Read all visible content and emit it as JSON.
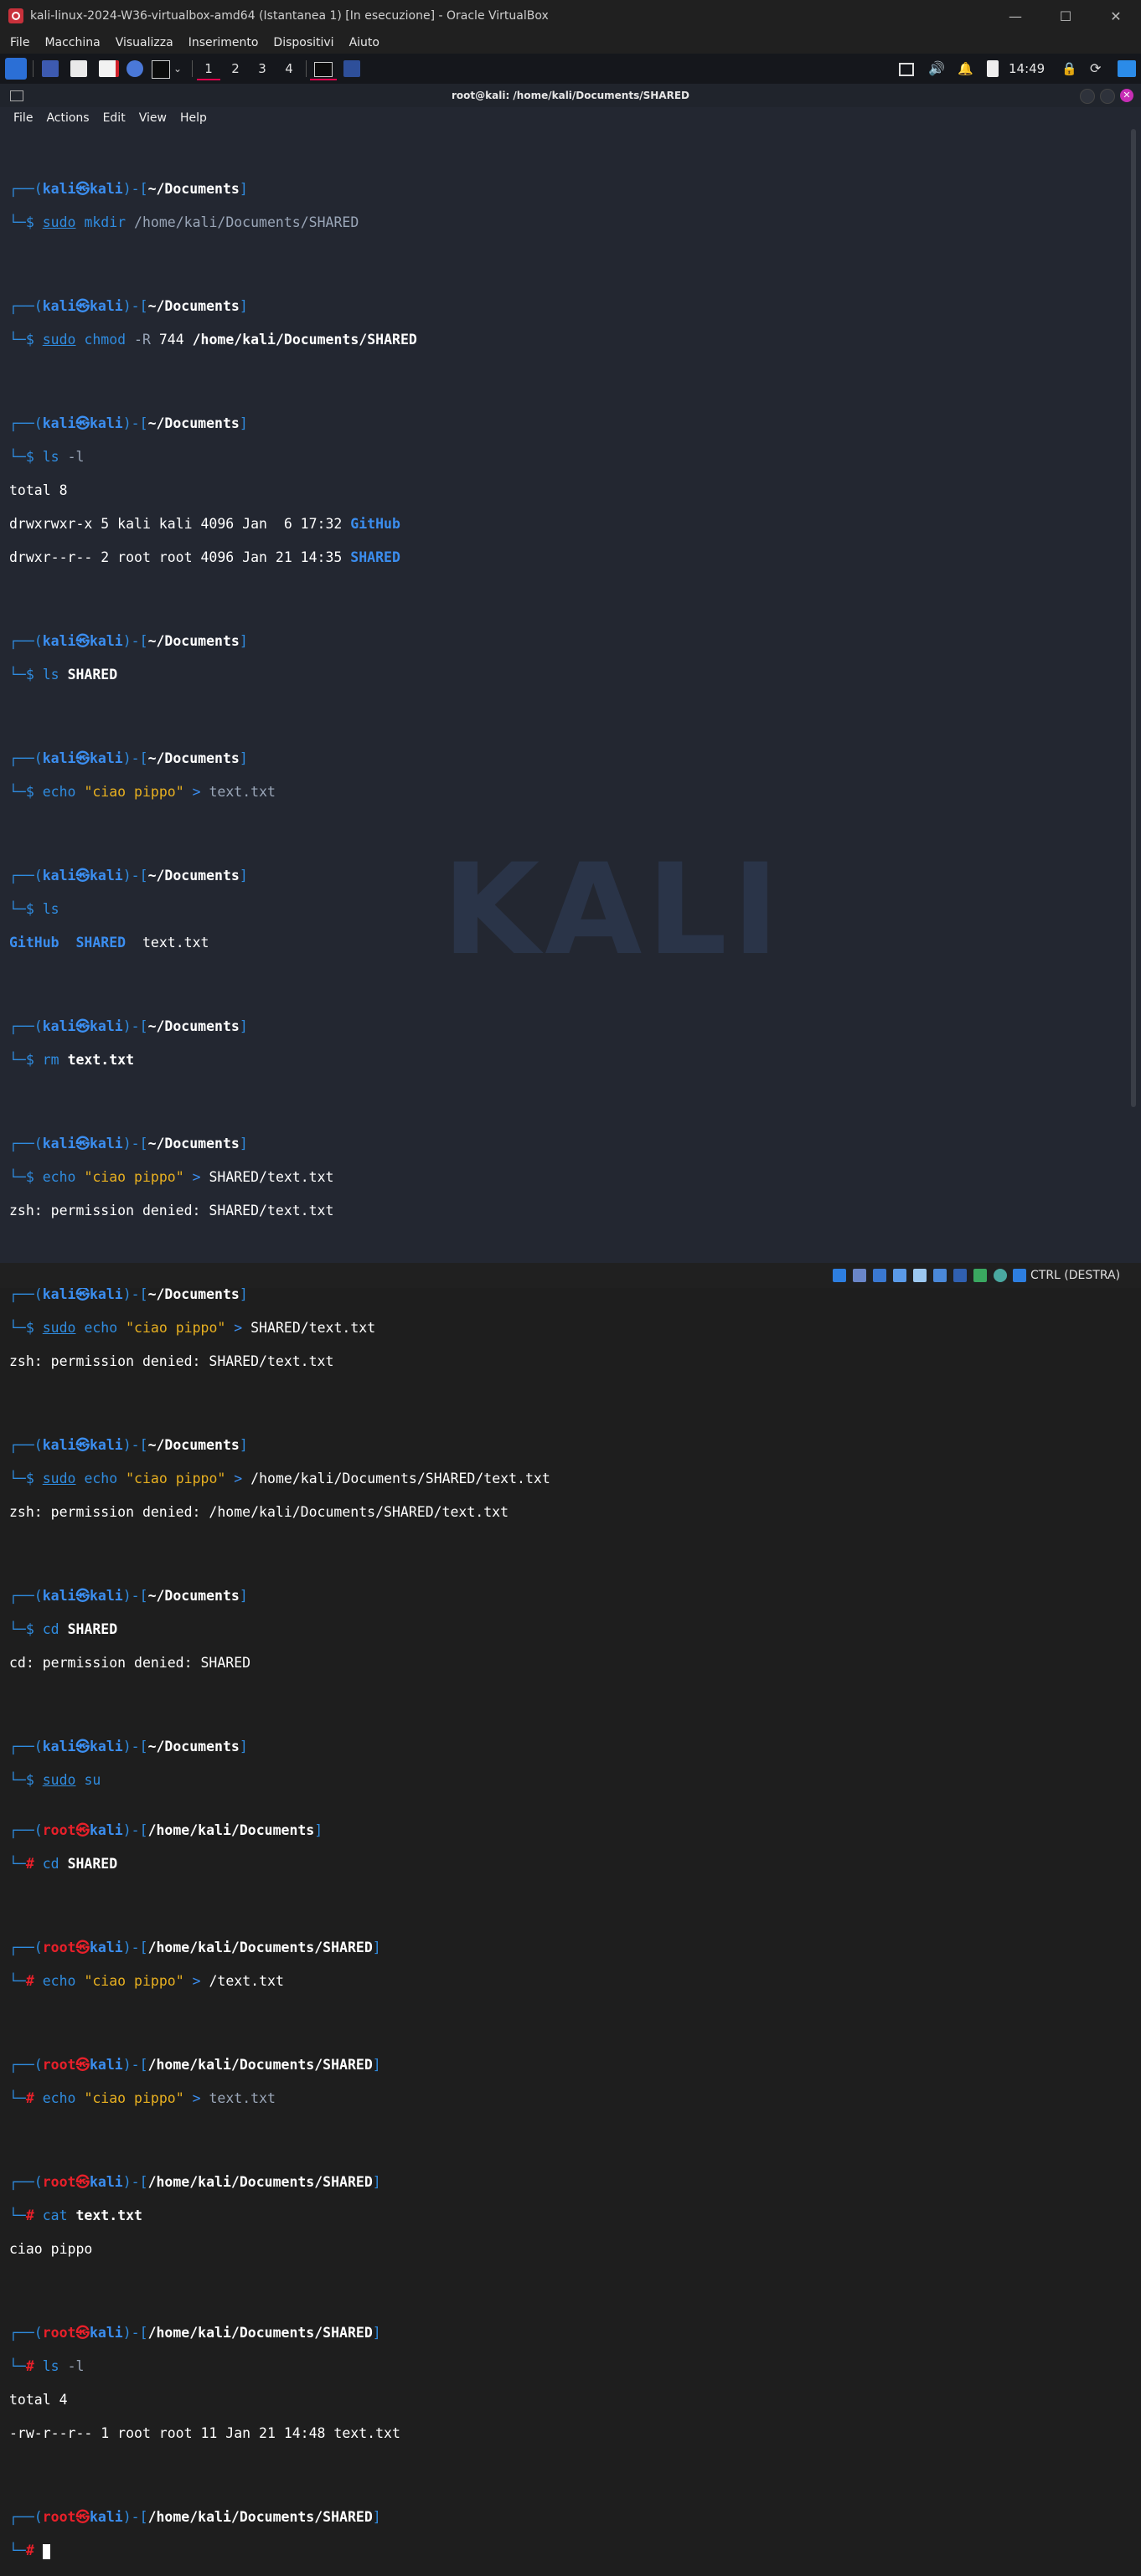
{
  "window": {
    "title": "kali-linux-2024-W36-virtualbox-amd64 (Istantanea 1) [In esecuzione] - Oracle VirtualBox",
    "menu": [
      "File",
      "Macchina",
      "Visualizza",
      "Inserimento",
      "Dispositivi",
      "Aiuto"
    ]
  },
  "panel": {
    "workspaces": [
      "1",
      "2",
      "3",
      "4"
    ],
    "clock": "14:49"
  },
  "terminal": {
    "title": "root@kali: /home/kali/Documents/SHARED",
    "menu": [
      "File",
      "Actions",
      "Edit",
      "View",
      "Help"
    ],
    "watermark": "KALI"
  },
  "prompt": {
    "user_kali": "kali",
    "user_root": "root",
    "host": "kali",
    "dir_docs": "~/Documents",
    "dir_abs": "/home/kali/Documents",
    "dir_shared": "/home/kali/Documents/SHARED"
  },
  "session": {
    "c1": {
      "sudo": "sudo",
      "cmd": "mkdir",
      "arg": "/home/kali/Documents/SHARED"
    },
    "c2": {
      "sudo": "sudo",
      "cmd": "chmod",
      "opt": "-R",
      "num": "744",
      "arg": "/home/kali/Documents/SHARED"
    },
    "c3": {
      "cmd": "ls",
      "opt": "-l",
      "out1": "total 8",
      "row1": "drwxrwxr-x 5 kali kali 4096 Jan  6 17:32 ",
      "row1_name": "GitHub",
      "row2": "drwxr--r-- 2 root root 4096 Jan 21 14:35 ",
      "row2_name": "SHARED"
    },
    "c4": {
      "cmd": "ls",
      "arg": "SHARED"
    },
    "c5": {
      "cmd": "echo",
      "str": "\"ciao pippo\"",
      "op": ">",
      "arg": "text.txt"
    },
    "c6": {
      "cmd": "ls",
      "o1": "GitHub",
      "o2": "SHARED",
      "o3": "text.txt"
    },
    "c7": {
      "cmd": "rm",
      "arg": "text.txt"
    },
    "c8": {
      "cmd": "echo",
      "str": "\"ciao pippo\"",
      "op": ">",
      "arg": "SHARED/text.txt",
      "out": "zsh: permission denied: SHARED/text.txt"
    },
    "c9": {
      "sudo": "sudo",
      "cmd": "echo",
      "str": "\"ciao pippo\"",
      "op": ">",
      "arg": "SHARED/text.txt",
      "out": "zsh: permission denied: SHARED/text.txt"
    },
    "c10": {
      "sudo": "sudo",
      "cmd": "echo",
      "str": "\"ciao pippo\"",
      "op": ">",
      "arg": "/home/kali/Documents/SHARED/text.txt",
      "out": "zsh: permission denied: /home/kali/Documents/SHARED/text.txt"
    },
    "c11": {
      "cmd": "cd",
      "arg": "SHARED",
      "out": "cd: permission denied: SHARED"
    },
    "c12": {
      "sudo": "sudo",
      "cmd": "su"
    },
    "c13": {
      "cmd": "cd",
      "arg": "SHARED"
    },
    "c14": {
      "cmd": "echo",
      "str": "\"ciao pippo\"",
      "op": ">",
      "arg": "/text.txt"
    },
    "c15": {
      "cmd": "echo",
      "str": "\"ciao pippo\"",
      "op": ">",
      "arg": "text.txt"
    },
    "c16": {
      "cmd": "cat",
      "arg": "text.txt",
      "out": "ciao pippo"
    },
    "c17": {
      "cmd": "ls",
      "opt": "-l",
      "out1": "total 4",
      "out2": "-rw-r--r-- 1 root root 11 Jan 21 14:48 text.txt"
    }
  },
  "statusbar": {
    "host_key": "CTRL (DESTRA)"
  },
  "colors": {
    "accent": "#e1004c",
    "prompt_blue": "#2f8ce0",
    "root_red": "#e8202a",
    "string_yellow": "#e8b020",
    "terminal_bg": "#232731"
  }
}
